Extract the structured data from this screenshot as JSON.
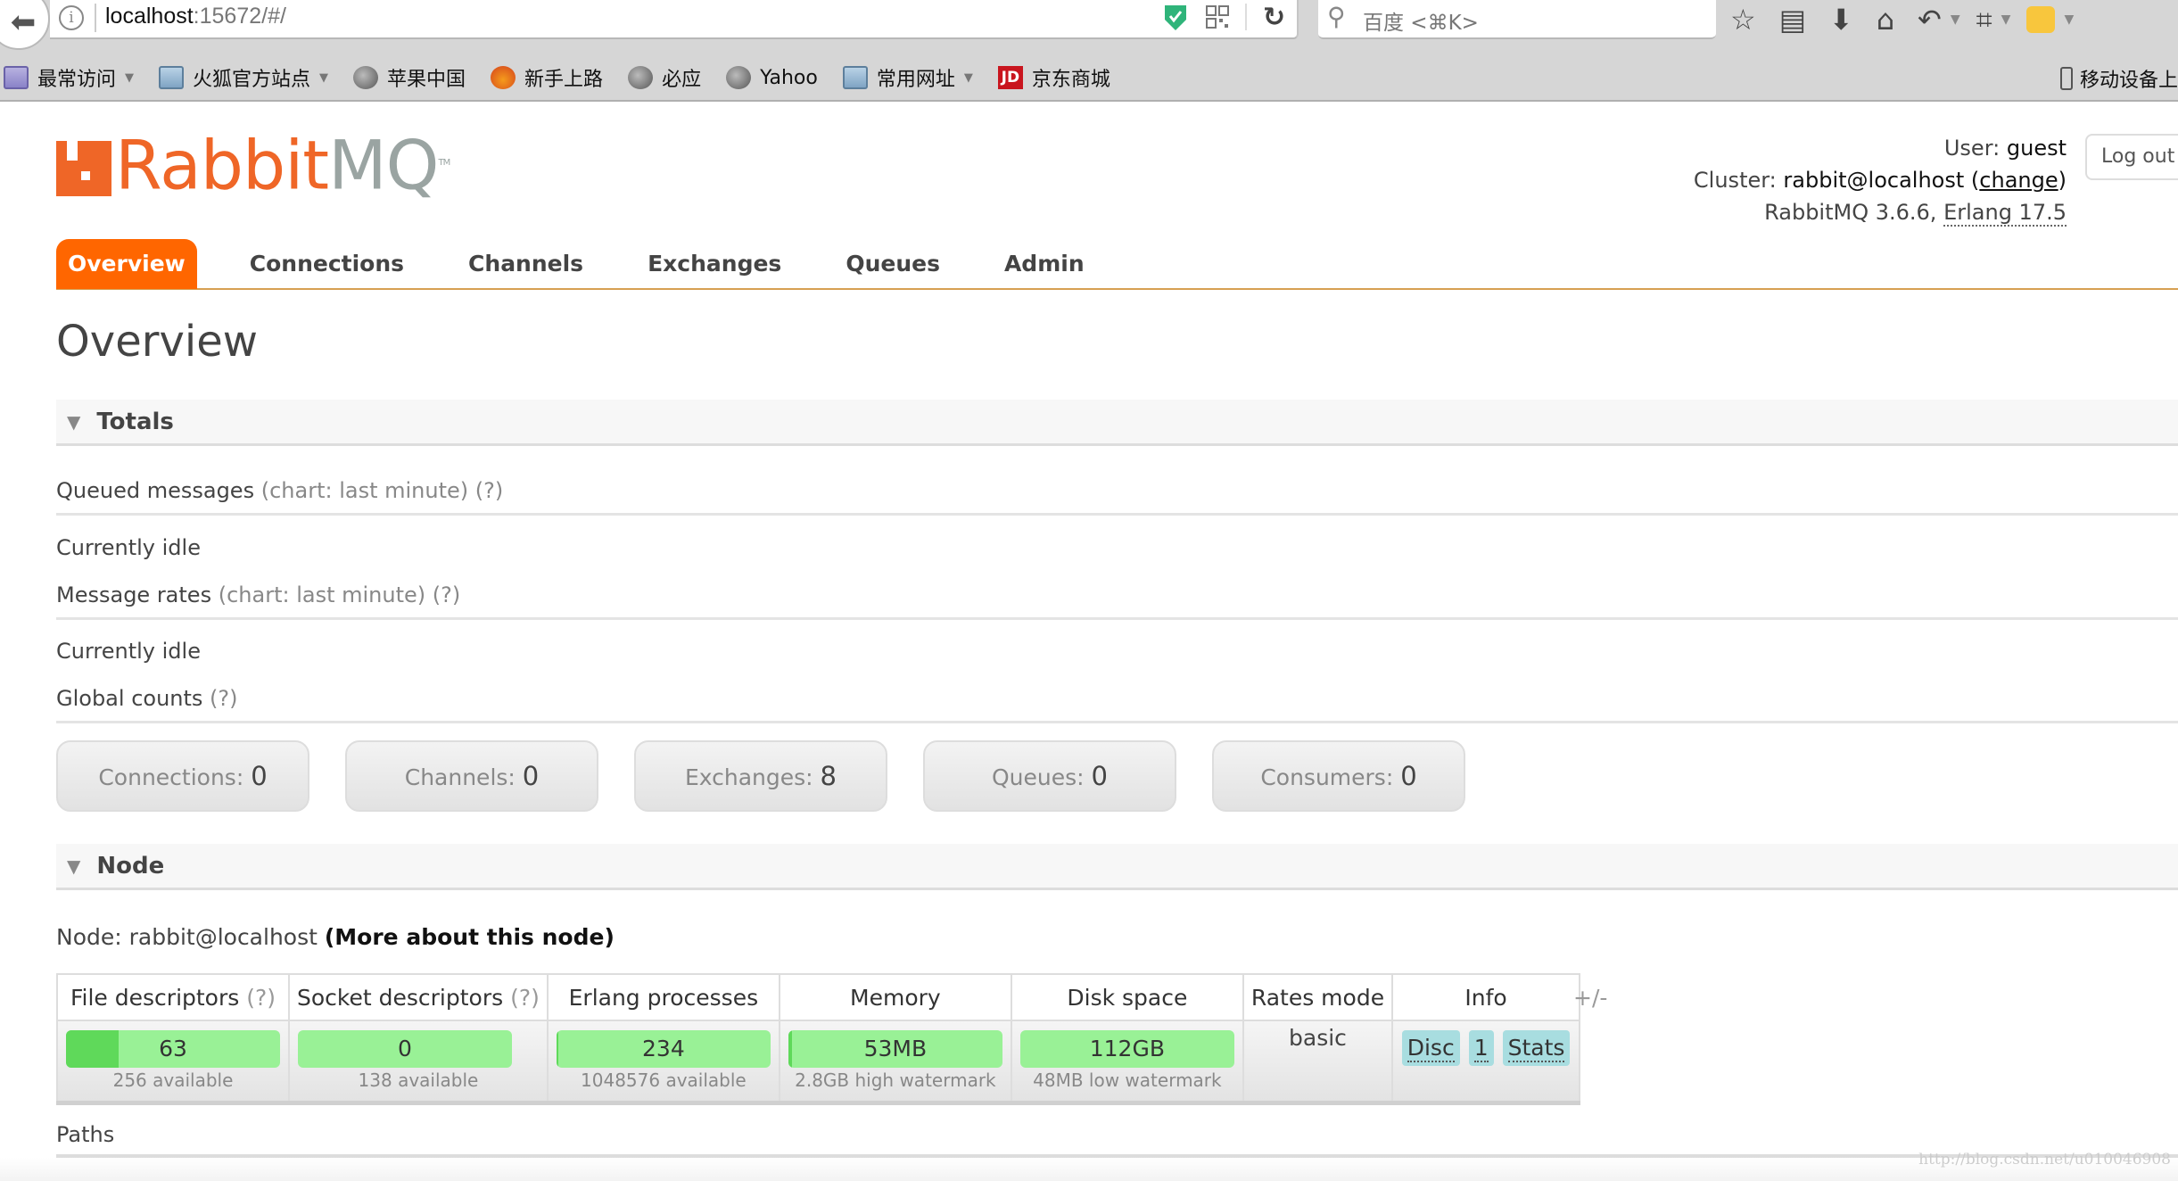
{
  "browser": {
    "url_host": "localhost",
    "url_rest": ":15672/#/",
    "search_placeholder": "百度 <⌘K>",
    "bookmarks": [
      {
        "label": "最常访问",
        "icon": "smart-folder-icon",
        "dropdown": true
      },
      {
        "label": "火狐官方站点",
        "icon": "folder-icon",
        "dropdown": true
      },
      {
        "label": "苹果中国",
        "icon": "globe-icon",
        "dropdown": false
      },
      {
        "label": "新手上路",
        "icon": "firefox-icon",
        "dropdown": false
      },
      {
        "label": "必应",
        "icon": "globe-icon",
        "dropdown": false
      },
      {
        "label": "Yahoo",
        "icon": "globe-icon",
        "dropdown": false
      },
      {
        "label": "常用网址",
        "icon": "folder-icon",
        "dropdown": true
      },
      {
        "label": "京东商城",
        "icon": "jd-icon",
        "dropdown": false
      }
    ],
    "mobile_bookmarks": "移动设备上",
    "jd_mark": "JD"
  },
  "header": {
    "logo_rabbit": "Rabbit",
    "logo_mq": "MQ",
    "logo_tm": "TM",
    "user_label": "User:",
    "user": "guest",
    "cluster_label": "Cluster:",
    "cluster": "rabbit@localhost",
    "change_link": "change",
    "version": "RabbitMQ 3.6.6,",
    "erlang": "Erlang 17.5",
    "logout": "Log out"
  },
  "nav": {
    "tabs": [
      "Overview",
      "Connections",
      "Channels",
      "Exchanges",
      "Queues",
      "Admin"
    ],
    "active": "Overview"
  },
  "page_title": "Overview",
  "totals": {
    "title": "Totals",
    "queued_messages": "Queued messages",
    "queued_chart": "(chart: last minute) (?)",
    "queued_status": "Currently idle",
    "message_rates": "Message rates",
    "rates_chart": "(chart: last minute) (?)",
    "rates_status": "Currently idle",
    "global_counts": "Global counts",
    "global_help": "(?)",
    "counts": [
      {
        "label": "Connections:",
        "value": "0"
      },
      {
        "label": "Channels:",
        "value": "0"
      },
      {
        "label": "Exchanges:",
        "value": "8"
      },
      {
        "label": "Queues:",
        "value": "0"
      },
      {
        "label": "Consumers:",
        "value": "0"
      }
    ]
  },
  "node": {
    "title": "Node",
    "node_label": "Node: rabbit@localhost",
    "more_link": "(More about this node)",
    "columns": [
      "File descriptors",
      "Socket descriptors",
      "Erlang processes",
      "Memory",
      "Disk space",
      "Rates mode",
      "Info"
    ],
    "help": "(?)",
    "file_descriptors": {
      "value": "63",
      "sub": "256 available",
      "fill_fraction": 0.246
    },
    "socket_descriptors": {
      "value": "0",
      "sub": "138 available",
      "fill_fraction": 0
    },
    "erlang_processes": {
      "value": "234",
      "sub": "1048576 available",
      "fill_fraction": 0.0002
    },
    "memory": {
      "value": "53MB",
      "sub": "2.8GB high watermark",
      "fill_fraction": 0.018
    },
    "disk_space": {
      "value": "112GB",
      "sub": "48MB low watermark",
      "fill_fraction": 0
    },
    "rates_mode": "basic",
    "info_badges": [
      "Disc",
      "1",
      "Stats"
    ],
    "toggle_columns": "+/-"
  },
  "paths_title": "Paths",
  "watermark": "http://blog.csdn.net/u010046908",
  "colors": {
    "accent": "#ff6600",
    "bar_light": "#99f196",
    "bar_dark": "#5fd95a",
    "badge": "#a8dde0",
    "nav_underline": "#d7a052"
  }
}
